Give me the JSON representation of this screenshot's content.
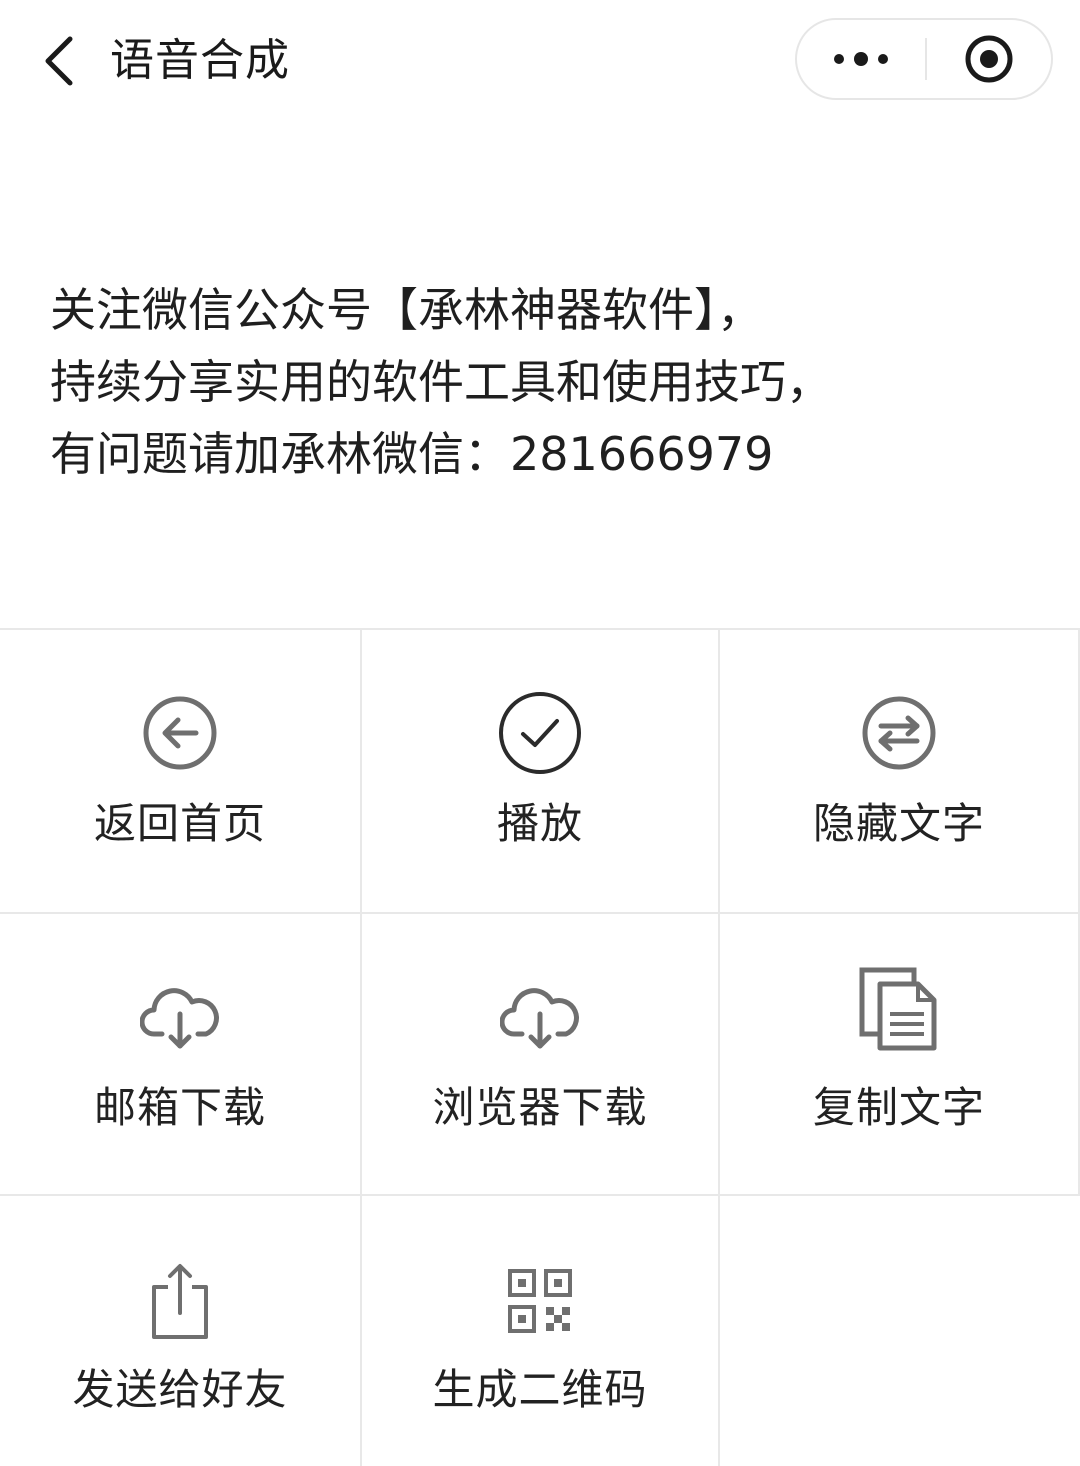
{
  "nav": {
    "title": "语音合成",
    "back_icon": "chevron-left-icon",
    "more_icon": "more-dots-icon",
    "close_icon": "target-close-icon"
  },
  "notice": {
    "lines": [
      "关注微信公众号【承林神器软件】，",
      "持续分享实用的软件工具和使用技巧，",
      "有问题请加承林微信：281666979"
    ]
  },
  "grid": {
    "items": [
      {
        "label": "返回首页",
        "icon": "circle-arrow-left-icon"
      },
      {
        "label": "播放",
        "icon": "circle-check-icon"
      },
      {
        "label": "隐藏文字",
        "icon": "circle-swap-icon"
      },
      {
        "label": "邮箱下载",
        "icon": "cloud-download-icon"
      },
      {
        "label": "浏览器下载",
        "icon": "cloud-download-icon"
      },
      {
        "label": "复制文字",
        "icon": "copy-document-icon"
      },
      {
        "label": "发送给好友",
        "icon": "share-icon"
      },
      {
        "label": "生成二维码",
        "icon": "qr-code-icon"
      }
    ]
  },
  "colors": {
    "icon_gray": "#6f6f6f",
    "icon_dark": "#2b2b2b",
    "divider": "#e8e8e8"
  }
}
